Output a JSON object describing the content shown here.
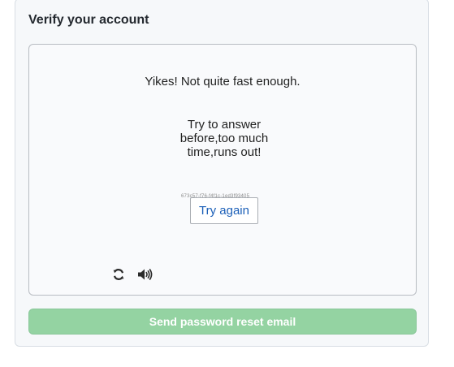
{
  "panel": {
    "title": "Verify your account"
  },
  "captcha": {
    "headline": "Yikes! Not quite fast enough.",
    "subtext_line1": "Try to answer",
    "subtext_line2": "before,too much",
    "subtext_line3": "time,runs out!",
    "session_id": "673c57-f76-f4f1c-1ed3f93405",
    "try_again_label": "Try again",
    "refresh_icon": "refresh-icon",
    "audio_icon": "audio-icon"
  },
  "actions": {
    "send_label": "Send password reset email",
    "send_color": "#94d3a2"
  }
}
